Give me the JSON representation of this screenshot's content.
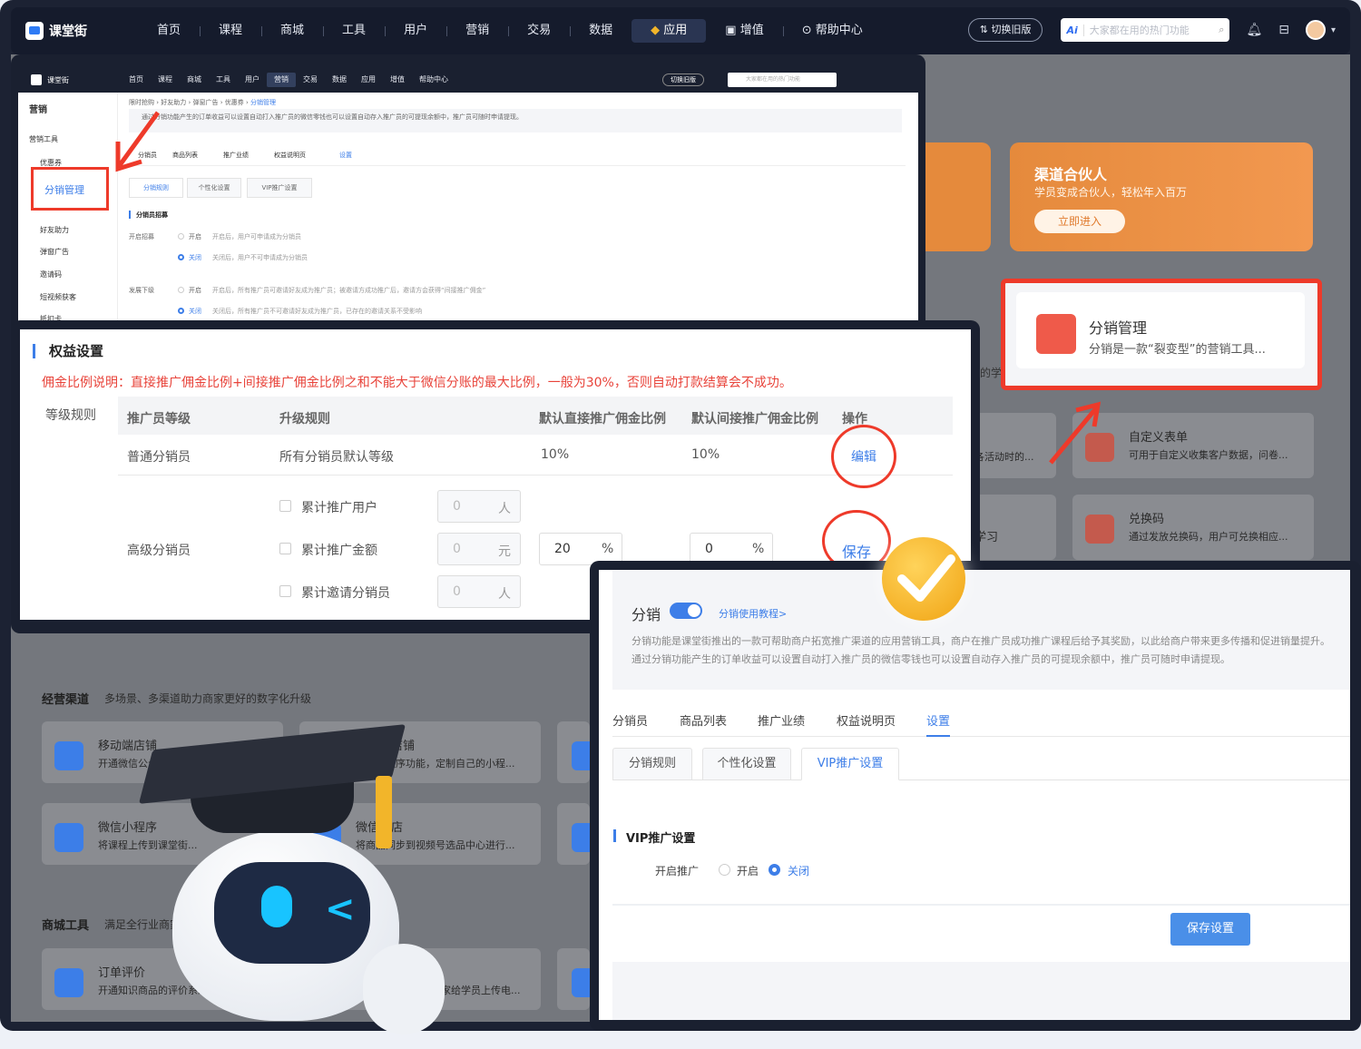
{
  "app": {
    "name": "课堂街"
  },
  "topnav": {
    "items": [
      "首页",
      "课程",
      "商城",
      "工具",
      "用户",
      "营销",
      "交易",
      "数据",
      "应用",
      "增值",
      "帮助中心"
    ],
    "active": "应用",
    "switch_old": "切换旧版",
    "search_ai": "Ai",
    "search_placeholder": "大家都在用的热门功能"
  },
  "promo": {
    "title": "渠道合伙人",
    "subtitle": "学员变成合伙人，轻松年入百万",
    "button": "立即进入"
  },
  "highlight_card": {
    "title": "分销管理",
    "desc": "分销是一款“裂变型”的营销工具..."
  },
  "bg_cards": {
    "custom_form": {
      "title": "自定义表单",
      "desc": "可用于自定义收集客户数据，问卷..."
    },
    "redeem": {
      "title": "兑换码",
      "desc": "通过发放兑换码，用户可兑换相应..."
    },
    "fragment1": "的学员",
    "fragment2": "各活动时的...",
    "fragment3": "学习"
  },
  "channels": {
    "title": "经营渠道",
    "subtitle": "多场景、多渠道助力商家更好的数字化升级",
    "mobile_store": {
      "title": "移动端店铺",
      "desc": "开通微信公众号绑定功能..."
    },
    "mini_store": {
      "title": "小程序店铺",
      "desc": "开通小程序功能，定制自己的小程..."
    },
    "wechat_mini": {
      "title": "微信小程序",
      "desc": "将课程上传到课堂街..."
    },
    "video_store": {
      "title": "微信小店",
      "desc": "将商品同步到视频号选品中心进行..."
    }
  },
  "mall_tools": {
    "title": "商城工具",
    "subtitle": "满足全行业商家",
    "order_review": {
      "title": "订单评价",
      "desc": "开通知识商品的评价系统..."
    },
    "other_desc": "家给学员上传电..."
  },
  "shot1": {
    "sidebar_title": "营销",
    "group": "营销工具",
    "items": [
      "优惠券",
      "分销管理",
      "好友助力",
      "弹窗广告",
      "邀请码",
      "短视频获客",
      "抵扣卡"
    ],
    "breadcrumb": [
      "限时抢购",
      "好友助力",
      "弹窗广告",
      "优惠券",
      "分销管理"
    ],
    "notice": "通过分销功能产生的订单收益可以设置自动打入推广员的微信零钱也可以设置自动存入推广员的可提现余额中，推广员可随时申请提现。",
    "tabs": [
      "分销员",
      "商品列表",
      "推广业绩",
      "权益说明页",
      "设置"
    ],
    "subtabs": [
      "分销规则",
      "个性化设置",
      "VIP推广设置"
    ],
    "section": "分销员招募",
    "recruit_label": "开启招募",
    "on": "开启",
    "off": "关闭",
    "recruit_on_desc": "开启后，用户可申请成为分销员",
    "recruit_off_desc": "关闭后，用户不可申请成为分销员",
    "develop_label": "发展下级",
    "develop_on_desc": "开启后，所有推广员可邀请好友成为推广员；被邀请方成功推广后，邀请方会获得“间接推广佣金”",
    "develop_off_desc": "关闭后，所有推广员不可邀请好友成为推广员，已存在的邀请关系不受影响"
  },
  "shot2": {
    "title": "权益设置",
    "warning": "佣金比例说明：直接推广佣金比例+间接推广佣金比例之和不能大于微信分账的最大比例，一般为30%，否则自动打款结算会不成功。",
    "level_label": "等级规则",
    "headers": [
      "推广员等级",
      "升级规则",
      "默认直接推广佣金比例",
      "默认间接推广佣金比例",
      "操作"
    ],
    "row1": {
      "level": "普通分销员",
      "rule": "所有分销员默认等级",
      "direct": "10%",
      "indirect": "10%",
      "action": "编辑"
    },
    "row2": {
      "level": "高级分销员",
      "conditions": [
        {
          "label": "累计推广用户",
          "value": "0",
          "unit": "人"
        },
        {
          "label": "累计推广金额",
          "value": "0",
          "unit": "元"
        },
        {
          "label": "累计邀请分销员",
          "value": "0",
          "unit": "人"
        }
      ],
      "direct": "20",
      "indirect": "0",
      "unit": "%",
      "action": "保存"
    }
  },
  "shot3": {
    "title": "分销",
    "tutorial": "分销使用教程>",
    "desc1": "分销功能是课堂街推出的一款可帮助商户拓宽推广渠道的应用营销工具，商户在推广员成功推广课程后给予其奖励，以此给商户带来更多传播和促进销量提升。",
    "desc2": "通过分销功能产生的订单收益可以设置自动打入推广员的微信零钱也可以设置自动存入推广员的可提现余额中，推广员可随时申请提现。",
    "tabs": [
      "分销员",
      "商品列表",
      "推广业绩",
      "权益说明页",
      "设置"
    ],
    "active_tab": "设置",
    "subtabs": [
      "分销规则",
      "个性化设置",
      "VIP推广设置"
    ],
    "active_subtab": "VIP推广设置",
    "section": "VIP推广设置",
    "option_label": "开启推广",
    "on": "开启",
    "off": "关闭",
    "selected": "关闭",
    "save": "保存设置"
  },
  "colors": {
    "accent": "#3d7ee8",
    "highlight": "#ee3a2a",
    "warning": "#e8433a",
    "promo": "#e58a3c"
  }
}
